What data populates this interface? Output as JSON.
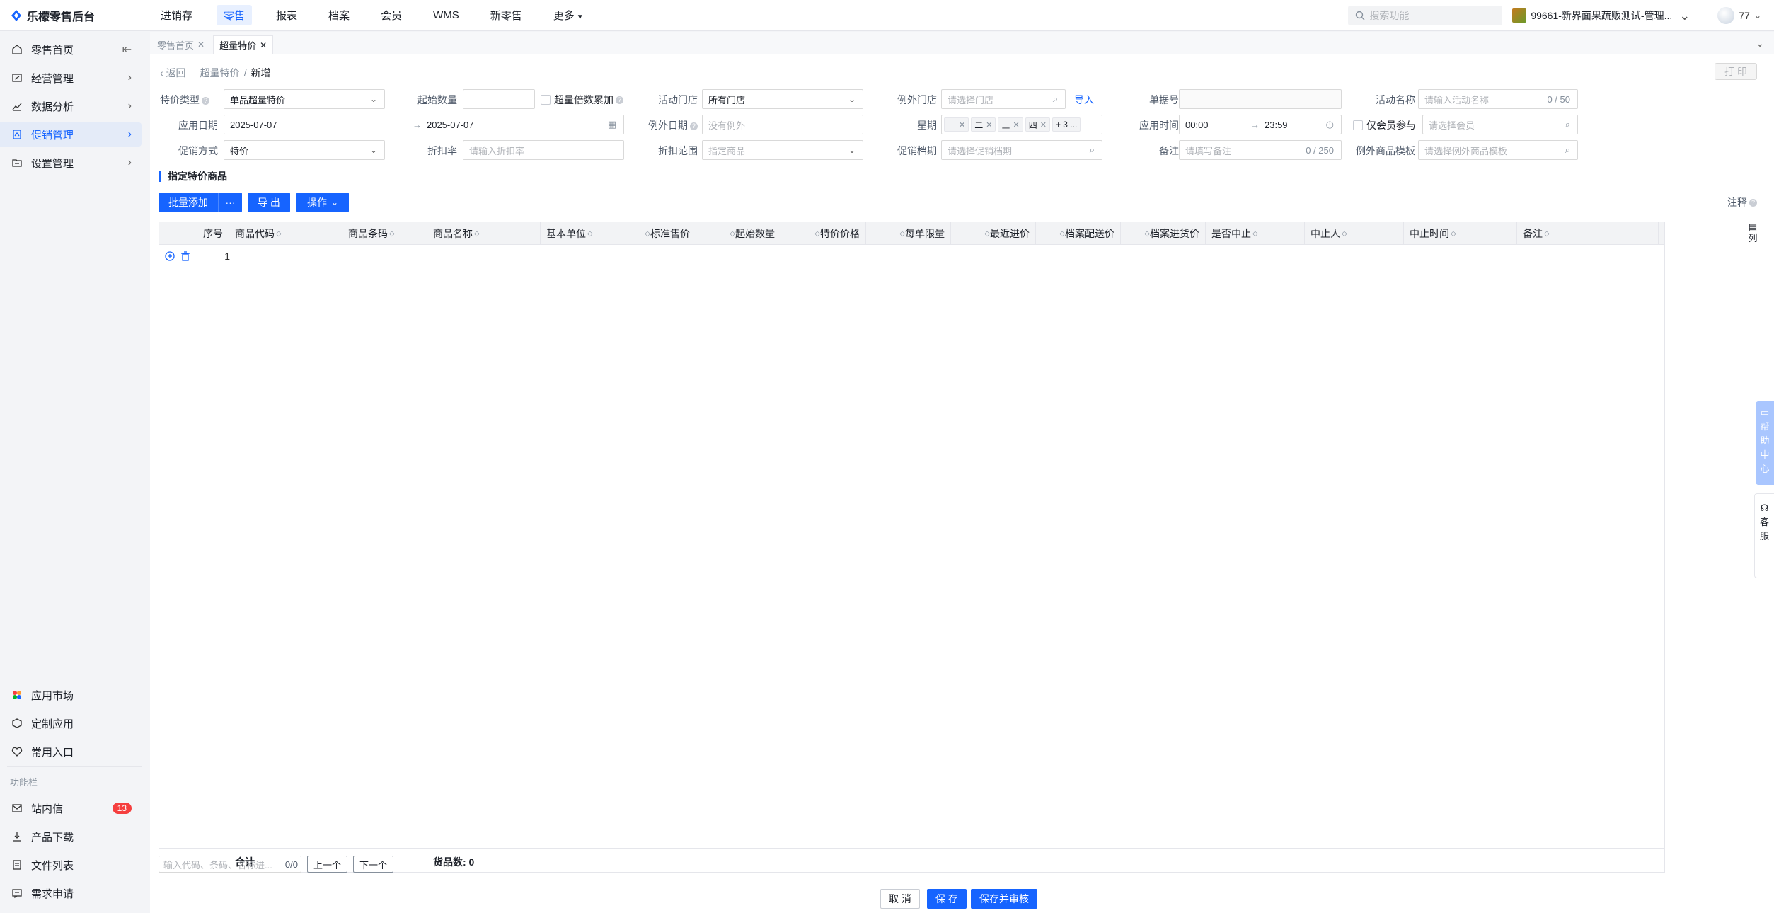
{
  "app": {
    "title": "乐檬零售后台"
  },
  "topnav": {
    "items": [
      "进销存",
      "零售",
      "报表",
      "档案",
      "会员",
      "WMS",
      "新零售",
      "更多"
    ],
    "active": "零售",
    "search_placeholder": "搜索功能",
    "shop": "99661-新界面果蔬贩测试-管理...",
    "user": "77"
  },
  "sidebar": {
    "items": [
      {
        "label": "零售首页",
        "icon": "home-icon"
      },
      {
        "label": "经营管理",
        "icon": "dashboard-icon"
      },
      {
        "label": "数据分析",
        "icon": "chart-line-icon"
      },
      {
        "label": "促销管理",
        "icon": "promotion-icon"
      },
      {
        "label": "设置管理",
        "icon": "settings-folder-icon"
      }
    ],
    "active": "促销管理",
    "apps": [
      {
        "label": "应用市场",
        "icon": "app-market-icon"
      },
      {
        "label": "定制应用",
        "icon": "custom-app-icon"
      },
      {
        "label": "常用入口",
        "icon": "heart-icon"
      }
    ],
    "function_section_label": "功能栏",
    "functions": [
      {
        "label": "站内信",
        "icon": "mail-icon",
        "badge": "13"
      },
      {
        "label": "产品下载",
        "icon": "download-icon"
      },
      {
        "label": "文件列表",
        "icon": "file-list-icon"
      },
      {
        "label": "需求申请",
        "icon": "request-icon"
      }
    ]
  },
  "tabs": [
    {
      "label": "零售首页"
    },
    {
      "label": "超量特价"
    }
  ],
  "breadcrumb": {
    "back": "返回",
    "parent": "超量特价",
    "separator": "/",
    "current": "新增"
  },
  "print_label": "打 印",
  "form": {
    "special_type": {
      "label": "特价类型",
      "value": "单品超量特价"
    },
    "start_qty": {
      "label": "起始数量",
      "value": ""
    },
    "over_multiple": {
      "label": "超量倍数累加"
    },
    "activity_store": {
      "label": "活动门店",
      "value": "所有门店"
    },
    "exclude_store": {
      "label": "例外门店",
      "placeholder": "请选择门店",
      "import_label": "导入"
    },
    "doc_no": {
      "label": "单据号",
      "value": ""
    },
    "activity_name": {
      "label": "活动名称",
      "placeholder": "请输入活动名称",
      "counter": "0 / 50"
    },
    "apply_date": {
      "label": "应用日期",
      "start": "2025-07-07",
      "end": "2025-07-07",
      "arrow": "→"
    },
    "exclude_date": {
      "label": "例外日期",
      "placeholder": "没有例外"
    },
    "weekday": {
      "label": "星期",
      "tags": [
        "一",
        "二",
        "三",
        "四"
      ],
      "more": "+ 3 ..."
    },
    "apply_time": {
      "label": "应用时间",
      "start": "00:00",
      "end": "23:59",
      "arrow": "→"
    },
    "member_only": {
      "label": "仅会员参与",
      "placeholder": "请选择会员"
    },
    "promo_method": {
      "label": "促销方式",
      "value": "特价"
    },
    "discount_rate": {
      "label": "折扣率",
      "placeholder": "请输入折扣率"
    },
    "discount_scope": {
      "label": "折扣范围",
      "placeholder": "指定商品"
    },
    "promo_schedule": {
      "label": "促销档期",
      "placeholder": "请选择促销档期"
    },
    "remark": {
      "label": "备注",
      "placeholder": "请填写备注",
      "counter": "0 / 250"
    },
    "exclude_template": {
      "label": "例外商品模板",
      "placeholder": "请选择例外商品模板"
    }
  },
  "section": {
    "title": "指定特价商品",
    "batch_add": "批量添加",
    "batch_more": "···",
    "export": "导 出",
    "operate": "操作",
    "notes": "注释"
  },
  "table": {
    "columns": [
      "序号",
      "商品代码",
      "商品条码",
      "商品名称",
      "基本单位",
      "标准售价",
      "起始数量",
      "特价价格",
      "每单限量",
      "最近进价",
      "档案配送价",
      "档案进货价",
      "是否中止",
      "中止人",
      "中止时间",
      "备注"
    ],
    "rows": [
      {
        "no": "1"
      }
    ],
    "column_settings": "列",
    "footer_total_label": "合计",
    "footer_count": "货品数: 0"
  },
  "finder": {
    "placeholder": "输入代码、条码、名称进...",
    "count": "0/0",
    "prev": "上一个",
    "next": "下一个"
  },
  "footer": {
    "cancel": "取 消",
    "save": "保 存",
    "save_audit": "保存并审核"
  },
  "float": {
    "help": "帮助中心",
    "service": "客服"
  },
  "colors": {
    "accent": "#1664ff",
    "badge": "#f53f3f"
  }
}
